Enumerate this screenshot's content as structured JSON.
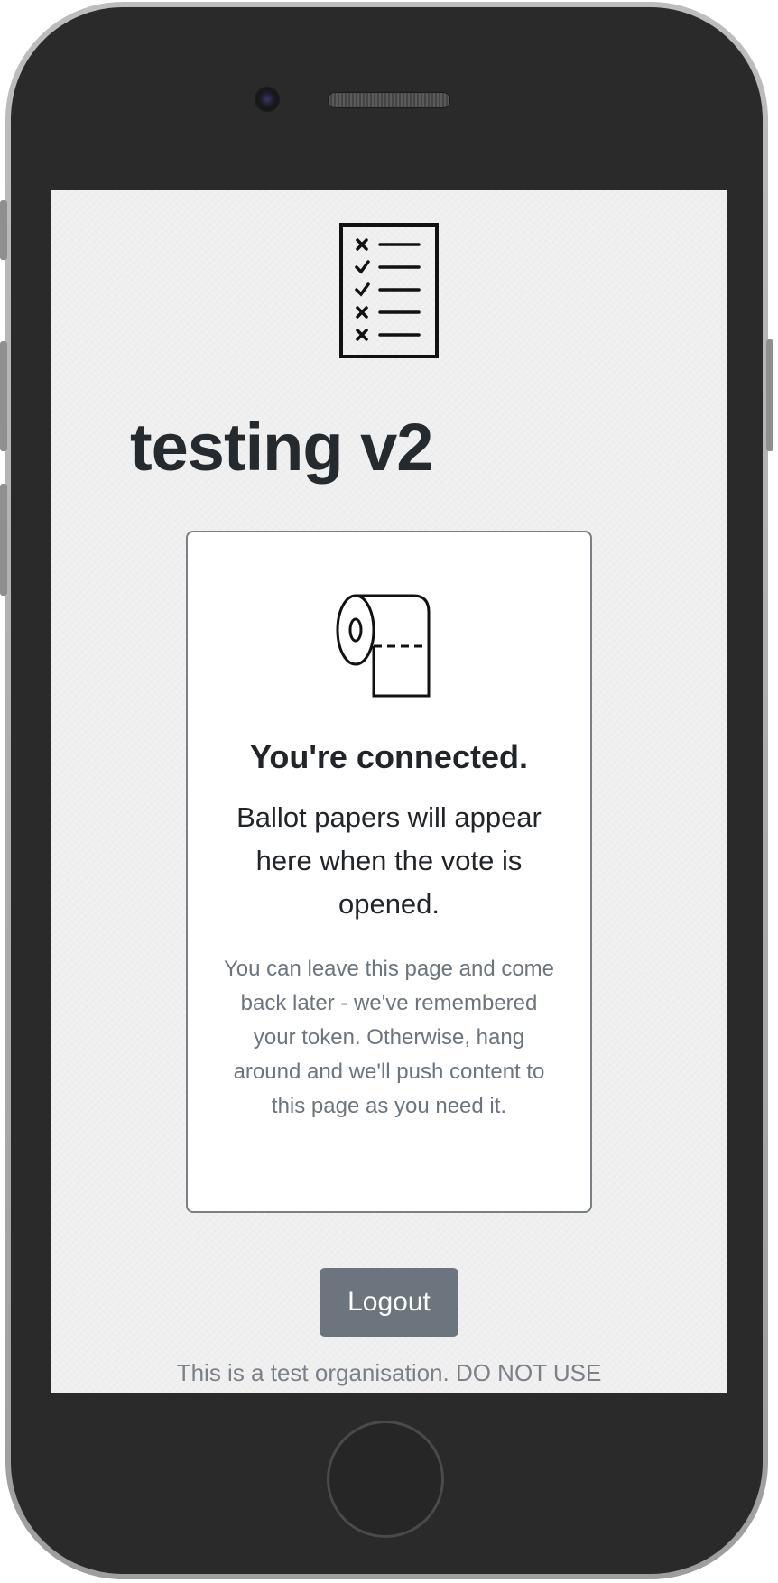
{
  "header": {
    "organisation_name": "testing v2",
    "logo_icon": "checklist-icon"
  },
  "status_card": {
    "icon": "toilet-roll-icon",
    "heading": "You're connected.",
    "lead": "Ballot papers will appear here when the vote is opened.",
    "note": "You can leave this page and come back later - we've remembered your token. Otherwise, hang around and we'll push content to this page as you need it."
  },
  "actions": {
    "logout_label": "Logout"
  },
  "footer": {
    "notice": "This is a test organisation. DO NOT USE"
  },
  "colors": {
    "background": "#f1f1f1",
    "text": "#212529",
    "muted": "#6c757d",
    "button": "#6c757d",
    "device_body": "#2a2a2a"
  }
}
